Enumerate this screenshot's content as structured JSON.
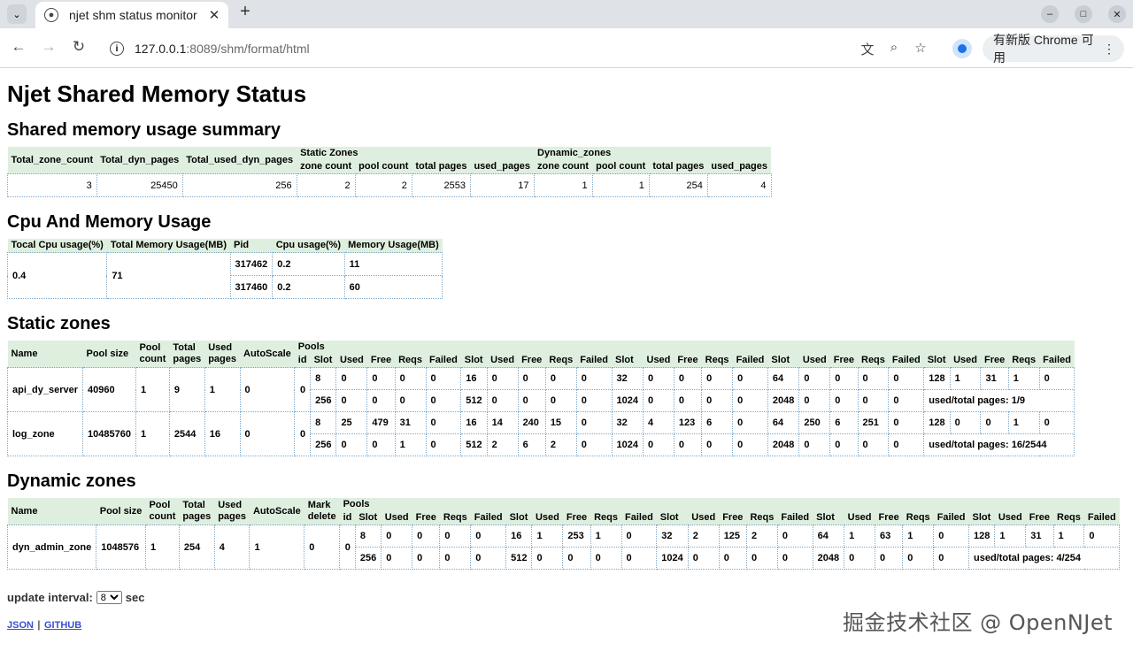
{
  "browser": {
    "tab_title": "njet shm status monitor",
    "url_host": "127.0.0.1",
    "url_rest": ":8089/shm/format/html",
    "upgrade_label": "有新版 Chrome 可用"
  },
  "page_title": "Njet Shared Memory Status",
  "summary": {
    "heading": "Shared memory usage summary",
    "h_total_zone": "Total_zone_count",
    "h_total_dyn": "Total_dyn_pages",
    "h_total_used": "Total_used_dyn_pages",
    "h_static": "Static Zones",
    "h_dynamic": "Dynamic_zones",
    "sub": [
      "zone count",
      "pool count",
      "total pages",
      "used_pages",
      "zone count",
      "pool count",
      "total pages",
      "used_pages"
    ],
    "values": [
      "3",
      "25450",
      "256",
      "2",
      "2",
      "2553",
      "17",
      "1",
      "1",
      "254",
      "4"
    ]
  },
  "cpu": {
    "heading": "Cpu And Memory Usage",
    "headers": [
      "Tocal Cpu usage(%)",
      "Total Memory Usage(MB)",
      "Pid",
      "Cpu usage(%)",
      "Memory Usage(MB)"
    ],
    "total_cpu": "0.4",
    "total_mem": "71",
    "rows": [
      [
        "317462",
        "0.2",
        "11"
      ],
      [
        "317460",
        "0.2",
        "60"
      ]
    ]
  },
  "static_zones": {
    "heading": "Static zones",
    "h_name": "Name",
    "h_pool_size": "Pool size",
    "h_pool_count": [
      "Pool",
      "count"
    ],
    "h_total_pages": [
      "Total",
      "pages"
    ],
    "h_used_pages": [
      "Used",
      "pages"
    ],
    "h_autoscale": "AutoScale",
    "h_pools": "Pools",
    "h_id": "id",
    "h_cols": [
      "Slot",
      "Used",
      "Free",
      "Reqs",
      "Failed"
    ],
    "zones": [
      {
        "name": "api_dy_server",
        "pool_size": "40960",
        "pool_count": "1",
        "total_pages": "9",
        "used_pages": "1",
        "autoscale": "0",
        "id": "0",
        "row1": [
          "8",
          "0",
          "0",
          "0",
          "0",
          "16",
          "0",
          "0",
          "0",
          "0",
          "32",
          "0",
          "0",
          "0",
          "0",
          "64",
          "0",
          "0",
          "0",
          "0",
          "128",
          "1",
          "31",
          "1",
          "0"
        ],
        "row2": [
          "256",
          "0",
          "0",
          "0",
          "0",
          "512",
          "0",
          "0",
          "0",
          "0",
          "1024",
          "0",
          "0",
          "0",
          "0",
          "2048",
          "0",
          "0",
          "0",
          "0"
        ],
        "pages": "used/total pages: 1/9"
      },
      {
        "name": "log_zone",
        "pool_size": "10485760",
        "pool_count": "1",
        "total_pages": "2544",
        "used_pages": "16",
        "autoscale": "0",
        "id": "0",
        "row1": [
          "8",
          "25",
          "479",
          "31",
          "0",
          "16",
          "14",
          "240",
          "15",
          "0",
          "32",
          "4",
          "123",
          "6",
          "0",
          "64",
          "250",
          "6",
          "251",
          "0",
          "128",
          "0",
          "0",
          "1",
          "0"
        ],
        "row2": [
          "256",
          "0",
          "0",
          "1",
          "0",
          "512",
          "2",
          "6",
          "2",
          "0",
          "1024",
          "0",
          "0",
          "0",
          "0",
          "2048",
          "0",
          "0",
          "0",
          "0"
        ],
        "pages": "used/total pages: 16/2544"
      }
    ]
  },
  "dynamic_zones": {
    "heading": "Dynamic zones",
    "h_name": "Name",
    "h_pool_size": "Pool size",
    "h_pool_count": [
      "Pool",
      "count"
    ],
    "h_total_pages": [
      "Total",
      "pages"
    ],
    "h_used_pages": [
      "Used",
      "pages"
    ],
    "h_autoscale": "AutoScale",
    "h_mark_delete": [
      "Mark",
      "delete"
    ],
    "h_pools": "Pools",
    "h_id": "id",
    "h_cols": [
      "Slot",
      "Used",
      "Free",
      "Reqs",
      "Failed"
    ],
    "zones": [
      {
        "name": "dyn_admin_zone",
        "pool_size": "1048576",
        "pool_count": "1",
        "total_pages": "254",
        "used_pages": "4",
        "autoscale": "1",
        "mark_delete": "0",
        "id": "0",
        "row1": [
          "8",
          "0",
          "0",
          "0",
          "0",
          "16",
          "1",
          "253",
          "1",
          "0",
          "32",
          "2",
          "125",
          "2",
          "0",
          "64",
          "1",
          "63",
          "1",
          "0",
          "128",
          "1",
          "31",
          "1",
          "0"
        ],
        "row2": [
          "256",
          "0",
          "0",
          "0",
          "0",
          "512",
          "0",
          "0",
          "0",
          "0",
          "1024",
          "0",
          "0",
          "0",
          "0",
          "2048",
          "0",
          "0",
          "0",
          "0"
        ],
        "pages": "used/total pages: 4/254"
      }
    ]
  },
  "footer": {
    "interval_label": "update interval:",
    "interval_value": "8",
    "interval_unit": "sec",
    "link_json": "JSON",
    "separator": "|",
    "link_github": "GITHUB"
  },
  "watermark": "掘金技术社区 @ OpenNJet"
}
